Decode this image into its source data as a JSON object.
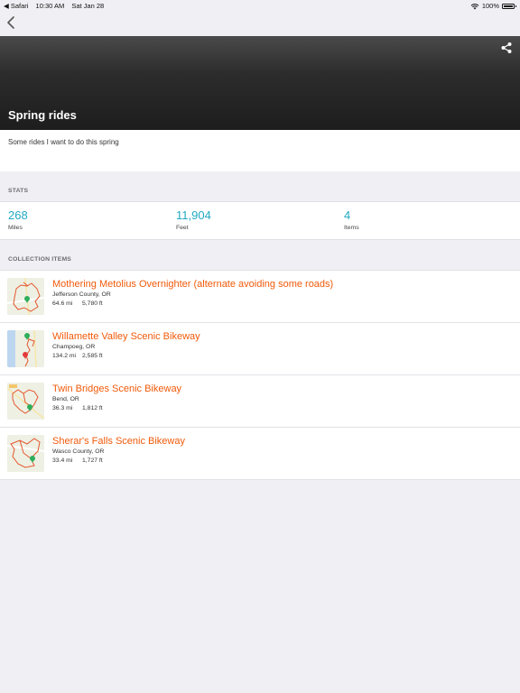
{
  "status_bar": {
    "app": "◀ Safari",
    "time": "10:30 AM",
    "date": "Sat Jan 28",
    "battery": "100%"
  },
  "header": {
    "title": "Spring rides"
  },
  "description": "Some rides I want to do this spring",
  "stats": {
    "section_label": "STATS",
    "miles": {
      "value": "268",
      "label": "Miles"
    },
    "feet": {
      "value": "11,904",
      "label": "Feet"
    },
    "items": {
      "value": "4",
      "label": "Items"
    }
  },
  "collection": {
    "section_label": "COLLECTION ITEMS",
    "items": [
      {
        "title": "Mothering Metolius Overnighter (alternate avoiding some roads)",
        "location": "Jefferson County, OR",
        "distance": "64.6 mi",
        "elevation": "5,780 ft"
      },
      {
        "title": "Willamette Valley Scenic Bikeway",
        "location": "Champoeg, OR",
        "distance": "134.2 mi",
        "elevation": "2,585 ft"
      },
      {
        "title": "Twin Bridges Scenic Bikeway",
        "location": "Bend, OR",
        "distance": "36.3 mi",
        "elevation": "1,812 ft"
      },
      {
        "title": "Sherar's Falls Scenic Bikeway",
        "location": "Wasco County, OR",
        "distance": "33.4 mi",
        "elevation": "1,727 ft"
      }
    ]
  },
  "colors": {
    "accent_orange": "#f15a0a",
    "stat_teal": "#21a9c3",
    "background": "#efeff4",
    "header_dark": "#1d1d1d"
  }
}
